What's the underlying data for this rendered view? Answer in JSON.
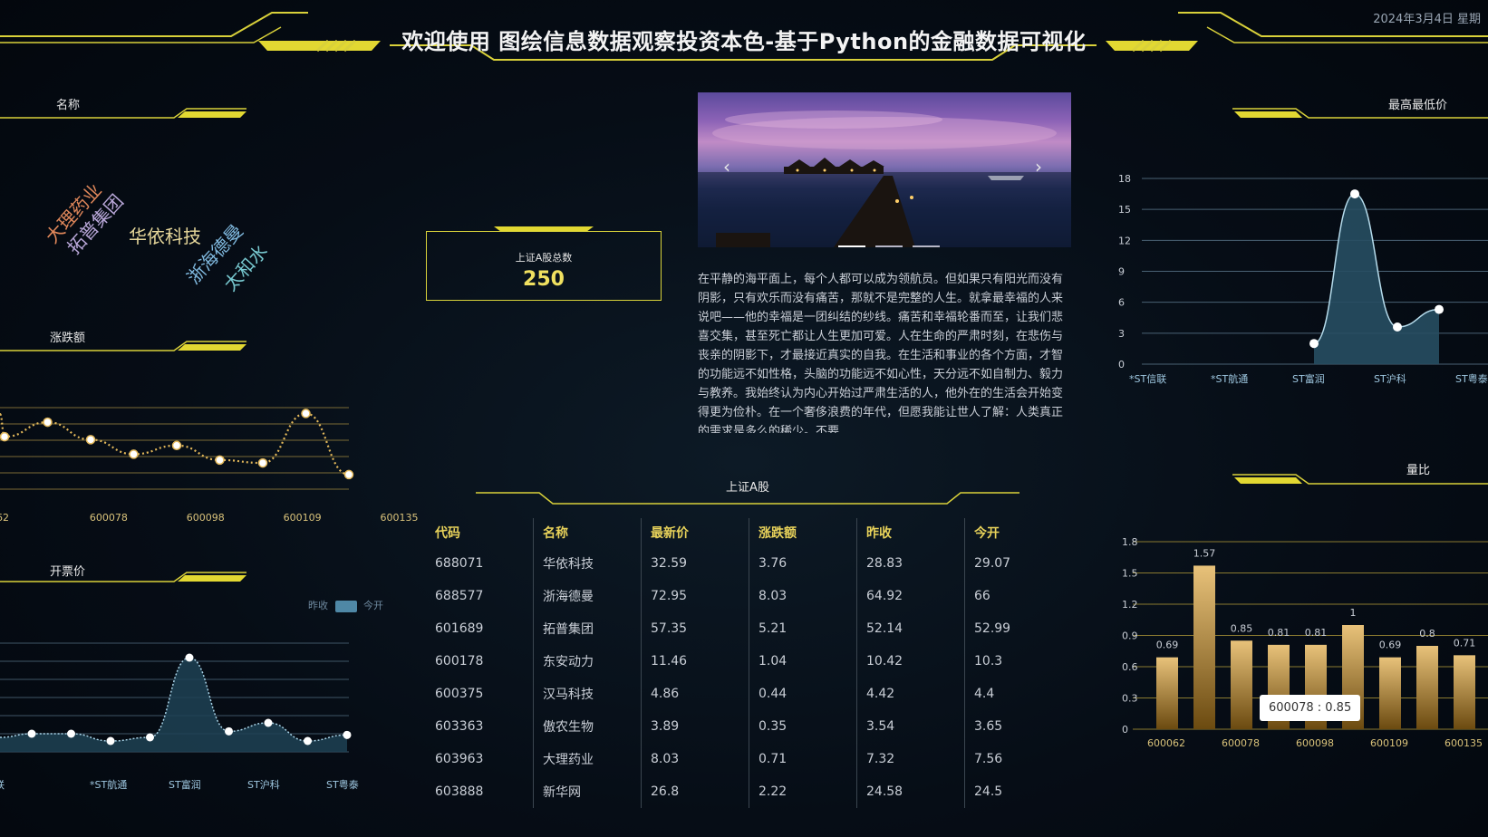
{
  "header": {
    "title": "欢迎使用 图绘信息数据观察投资本色-基于Python的金融数据可视化",
    "date": "2024年3月4日 星期"
  },
  "panels": {
    "name_title": "名称",
    "change_title": "涨跌额",
    "open_title": "开票价",
    "high_low_title": "最高最低价",
    "volume_ratio_title": "量比",
    "table_title": "上证A股",
    "legend_prev": "昨收",
    "legend_open": "今开"
  },
  "word_cloud": [
    {
      "text": "大理药业",
      "color": "#e0875a"
    },
    {
      "text": "拓普集团",
      "color": "#b9a7d8"
    },
    {
      "text": "华依科技",
      "color": "#e6d79a"
    },
    {
      "text": "浙海德曼",
      "color": "#7fb8de"
    },
    {
      "text": "太和水",
      "color": "#78c9d0"
    }
  ],
  "stat": {
    "label": "上证A股总数",
    "value": "250"
  },
  "carousel": {
    "prev": "‹",
    "next": "›"
  },
  "description": "在平静的海平面上，每个人都可以成为领航员。但如果只有阳光而没有阴影，只有欢乐而没有痛苦，那就不是完整的人生。就拿最幸福的人来说吧——他的幸福是一团纠结的纱线。痛苦和幸福轮番而至，让我们悲喜交集，甚至死亡都让人生更加可爱。人在生命的严肃时刻，在悲伤与丧亲的阴影下，才最接近真实的自我。在生活和事业的各个方面，才智的功能远不如性格，头脑的功能远不如心性，天分远不如自制力、毅力与教养。我始终认为内心开始过严肃生活的人，他外在的生活会开始变得更为俭朴。在一个奢侈浪费的年代，但愿我能让世人了解：人类真正的需求是多么的稀少。不要",
  "table": {
    "headers": [
      "代码",
      "名称",
      "最新价",
      "涨跌额",
      "昨收",
      "今开"
    ],
    "rows": [
      [
        "688071",
        "华依科技",
        "32.59",
        "3.76",
        "28.83",
        "29.07"
      ],
      [
        "688577",
        "浙海德曼",
        "72.95",
        "8.03",
        "64.92",
        "66"
      ],
      [
        "601689",
        "拓普集团",
        "57.35",
        "5.21",
        "52.14",
        "52.99"
      ],
      [
        "600178",
        "东安动力",
        "11.46",
        "1.04",
        "10.42",
        "10.3"
      ],
      [
        "600375",
        "汉马科技",
        "4.86",
        "0.44",
        "4.42",
        "4.4"
      ],
      [
        "603363",
        "傲农生物",
        "3.89",
        "0.35",
        "3.54",
        "3.65"
      ],
      [
        "603963",
        "大理药业",
        "8.03",
        "0.71",
        "7.32",
        "7.56"
      ],
      [
        "603888",
        "新华网",
        "26.8",
        "2.22",
        "24.58",
        "24.5"
      ]
    ]
  },
  "chart_data": [
    {
      "type": "line",
      "title": "涨跌额",
      "x": [
        "62",
        "",
        "600078",
        "",
        "600098",
        "",
        "600109",
        "",
        "600135",
        ""
      ],
      "values": [
        1.8,
        2.3,
        1.7,
        1.2,
        1.5,
        1.0,
        0.9,
        2.6,
        0.5
      ]
    },
    {
      "type": "area",
      "title": "开票价",
      "x": [
        "联",
        "",
        "*ST航通",
        "",
        "ST富润",
        "",
        "ST沪科",
        "",
        "ST粤泰",
        ""
      ],
      "values": [
        1.5,
        1.5,
        0.9,
        1.2,
        7.8,
        1.7,
        2.4,
        0.9,
        1.4
      ]
    },
    {
      "type": "area",
      "title": "最高最低价",
      "categories": [
        "*ST信联",
        "*ST航通",
        "ST富润",
        "ST沪科",
        "ST粤泰"
      ],
      "yticks": [
        "0",
        "3",
        "6",
        "9",
        "12",
        "15",
        "18"
      ],
      "ylim": [
        0,
        18
      ],
      "values": [
        2,
        16.5,
        3.6,
        5.3
      ]
    },
    {
      "type": "bar",
      "title": "量比",
      "categories": [
        "600062",
        "",
        "600078",
        "",
        "600098",
        "",
        "600109",
        "",
        "600135"
      ],
      "yticks": [
        "0",
        "0.3",
        "0.6",
        "0.9",
        "1.2",
        "1.5",
        "1.8"
      ],
      "ylim": [
        0,
        1.8
      ],
      "values": [
        0.69,
        1.57,
        0.85,
        0.81,
        0.81,
        1,
        0.69,
        0.8,
        0.71
      ],
      "labels": [
        "0.69",
        "1.57",
        "0.85",
        "0.81",
        "0.81",
        "1",
        "0.69",
        "0.8",
        "0.71"
      ],
      "tooltip": "600078 : 0.85"
    }
  ]
}
